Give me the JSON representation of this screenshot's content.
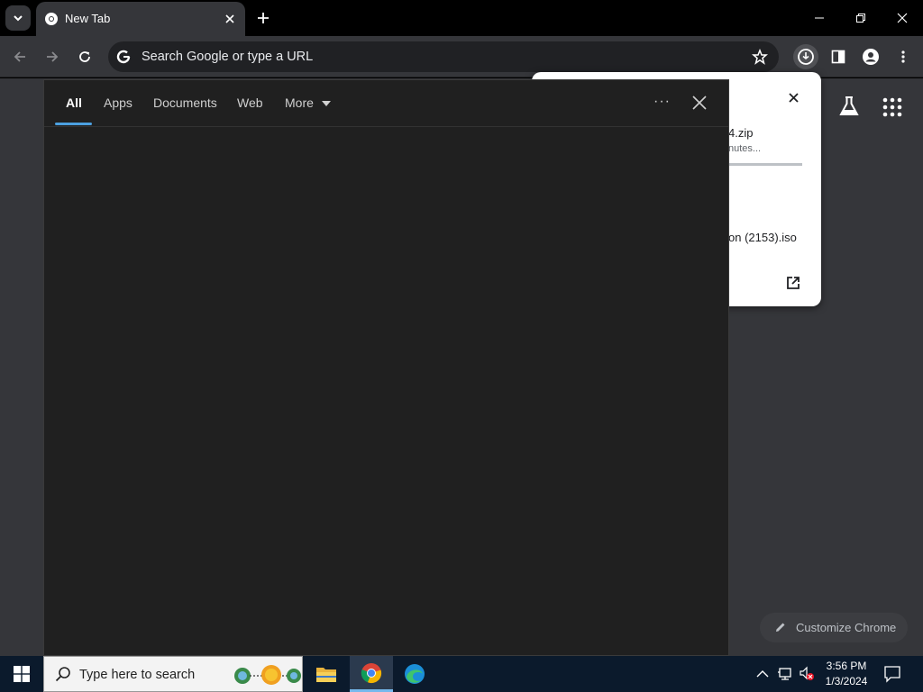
{
  "browser": {
    "tab_title": "New Tab",
    "omnibox_placeholder": "Search Google or type a URL"
  },
  "download_bubble": {
    "file1_name": "4.zip",
    "file1_status": "nutes...",
    "file1_progress": 1.0,
    "file2_name": "on (2153).iso"
  },
  "ntp": {
    "customize_label": "Customize Chrome"
  },
  "search_panel": {
    "tabs": [
      {
        "label": "All",
        "active": true
      },
      {
        "label": "Apps"
      },
      {
        "label": "Documents"
      },
      {
        "label": "Web"
      },
      {
        "label": "More"
      }
    ],
    "more_options": "···"
  },
  "taskbar": {
    "search_placeholder": "Type here to search",
    "time": "3:56 PM",
    "date": "1/3/2024"
  },
  "colors": {
    "accent": "#4ca0e0",
    "panel_bg": "#202020",
    "toolbar_bg": "#35363a",
    "taskbar_bg": "#0b1a2c"
  }
}
